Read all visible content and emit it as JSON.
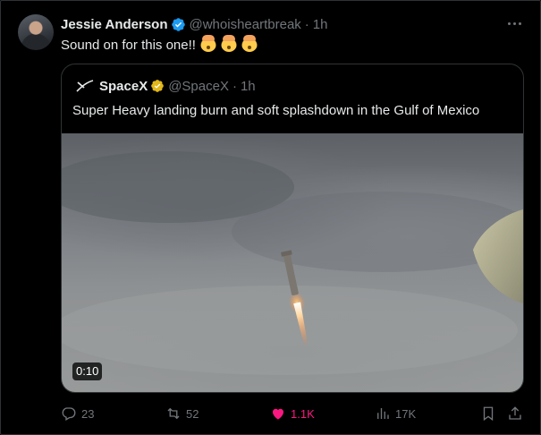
{
  "tweet": {
    "author_name": "Jessie Anderson",
    "author_handle": "@whoisheartbreak",
    "separator": "·",
    "time": "1h",
    "text": "Sound on for this one!!",
    "emoji": [
      "exploding-head",
      "exploding-head",
      "exploding-head"
    ]
  },
  "quote": {
    "author_name": "SpaceX",
    "author_handle": "@SpaceX",
    "separator": "·",
    "time": "1h",
    "text": "Super Heavy landing burn and soft splashdown in the Gulf of Mexico",
    "video_duration": "0:10"
  },
  "actions": {
    "replies": "23",
    "reposts": "52",
    "likes": "1.1K",
    "views": "17K"
  },
  "colors": {
    "background": "#000000",
    "text": "#e7e9ea",
    "muted": "#71767b",
    "border": "#2f3336",
    "verified_blue": "#1d9bf0",
    "verified_gold": "#e2b719",
    "like_pink": "#f91880"
  }
}
